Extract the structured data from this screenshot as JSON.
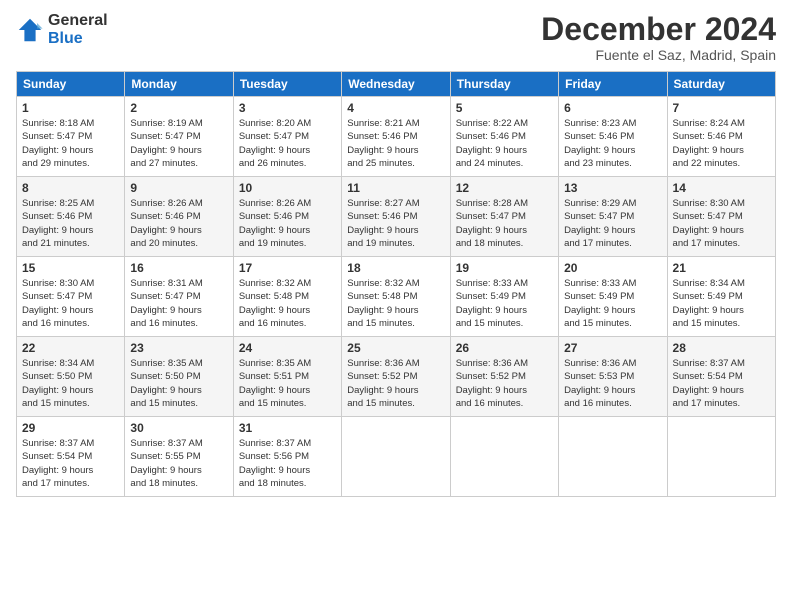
{
  "logo": {
    "line1": "General",
    "line2": "Blue"
  },
  "title": "December 2024",
  "location": "Fuente el Saz, Madrid, Spain",
  "days_header": [
    "Sunday",
    "Monday",
    "Tuesday",
    "Wednesday",
    "Thursday",
    "Friday",
    "Saturday"
  ],
  "weeks": [
    [
      {
        "day": "1",
        "info": "Sunrise: 8:18 AM\nSunset: 5:47 PM\nDaylight: 9 hours\nand 29 minutes."
      },
      {
        "day": "2",
        "info": "Sunrise: 8:19 AM\nSunset: 5:47 PM\nDaylight: 9 hours\nand 27 minutes."
      },
      {
        "day": "3",
        "info": "Sunrise: 8:20 AM\nSunset: 5:47 PM\nDaylight: 9 hours\nand 26 minutes."
      },
      {
        "day": "4",
        "info": "Sunrise: 8:21 AM\nSunset: 5:46 PM\nDaylight: 9 hours\nand 25 minutes."
      },
      {
        "day": "5",
        "info": "Sunrise: 8:22 AM\nSunset: 5:46 PM\nDaylight: 9 hours\nand 24 minutes."
      },
      {
        "day": "6",
        "info": "Sunrise: 8:23 AM\nSunset: 5:46 PM\nDaylight: 9 hours\nand 23 minutes."
      },
      {
        "day": "7",
        "info": "Sunrise: 8:24 AM\nSunset: 5:46 PM\nDaylight: 9 hours\nand 22 minutes."
      }
    ],
    [
      {
        "day": "8",
        "info": "Sunrise: 8:25 AM\nSunset: 5:46 PM\nDaylight: 9 hours\nand 21 minutes."
      },
      {
        "day": "9",
        "info": "Sunrise: 8:26 AM\nSunset: 5:46 PM\nDaylight: 9 hours\nand 20 minutes."
      },
      {
        "day": "10",
        "info": "Sunrise: 8:26 AM\nSunset: 5:46 PM\nDaylight: 9 hours\nand 19 minutes."
      },
      {
        "day": "11",
        "info": "Sunrise: 8:27 AM\nSunset: 5:46 PM\nDaylight: 9 hours\nand 19 minutes."
      },
      {
        "day": "12",
        "info": "Sunrise: 8:28 AM\nSunset: 5:47 PM\nDaylight: 9 hours\nand 18 minutes."
      },
      {
        "day": "13",
        "info": "Sunrise: 8:29 AM\nSunset: 5:47 PM\nDaylight: 9 hours\nand 17 minutes."
      },
      {
        "day": "14",
        "info": "Sunrise: 8:30 AM\nSunset: 5:47 PM\nDaylight: 9 hours\nand 17 minutes."
      }
    ],
    [
      {
        "day": "15",
        "info": "Sunrise: 8:30 AM\nSunset: 5:47 PM\nDaylight: 9 hours\nand 16 minutes."
      },
      {
        "day": "16",
        "info": "Sunrise: 8:31 AM\nSunset: 5:47 PM\nDaylight: 9 hours\nand 16 minutes."
      },
      {
        "day": "17",
        "info": "Sunrise: 8:32 AM\nSunset: 5:48 PM\nDaylight: 9 hours\nand 16 minutes."
      },
      {
        "day": "18",
        "info": "Sunrise: 8:32 AM\nSunset: 5:48 PM\nDaylight: 9 hours\nand 15 minutes."
      },
      {
        "day": "19",
        "info": "Sunrise: 8:33 AM\nSunset: 5:49 PM\nDaylight: 9 hours\nand 15 minutes."
      },
      {
        "day": "20",
        "info": "Sunrise: 8:33 AM\nSunset: 5:49 PM\nDaylight: 9 hours\nand 15 minutes."
      },
      {
        "day": "21",
        "info": "Sunrise: 8:34 AM\nSunset: 5:49 PM\nDaylight: 9 hours\nand 15 minutes."
      }
    ],
    [
      {
        "day": "22",
        "info": "Sunrise: 8:34 AM\nSunset: 5:50 PM\nDaylight: 9 hours\nand 15 minutes."
      },
      {
        "day": "23",
        "info": "Sunrise: 8:35 AM\nSunset: 5:50 PM\nDaylight: 9 hours\nand 15 minutes."
      },
      {
        "day": "24",
        "info": "Sunrise: 8:35 AM\nSunset: 5:51 PM\nDaylight: 9 hours\nand 15 minutes."
      },
      {
        "day": "25",
        "info": "Sunrise: 8:36 AM\nSunset: 5:52 PM\nDaylight: 9 hours\nand 15 minutes."
      },
      {
        "day": "26",
        "info": "Sunrise: 8:36 AM\nSunset: 5:52 PM\nDaylight: 9 hours\nand 16 minutes."
      },
      {
        "day": "27",
        "info": "Sunrise: 8:36 AM\nSunset: 5:53 PM\nDaylight: 9 hours\nand 16 minutes."
      },
      {
        "day": "28",
        "info": "Sunrise: 8:37 AM\nSunset: 5:54 PM\nDaylight: 9 hours\nand 17 minutes."
      }
    ],
    [
      {
        "day": "29",
        "info": "Sunrise: 8:37 AM\nSunset: 5:54 PM\nDaylight: 9 hours\nand 17 minutes."
      },
      {
        "day": "30",
        "info": "Sunrise: 8:37 AM\nSunset: 5:55 PM\nDaylight: 9 hours\nand 18 minutes."
      },
      {
        "day": "31",
        "info": "Sunrise: 8:37 AM\nSunset: 5:56 PM\nDaylight: 9 hours\nand 18 minutes."
      },
      {
        "day": "",
        "info": ""
      },
      {
        "day": "",
        "info": ""
      },
      {
        "day": "",
        "info": ""
      },
      {
        "day": "",
        "info": ""
      }
    ]
  ]
}
